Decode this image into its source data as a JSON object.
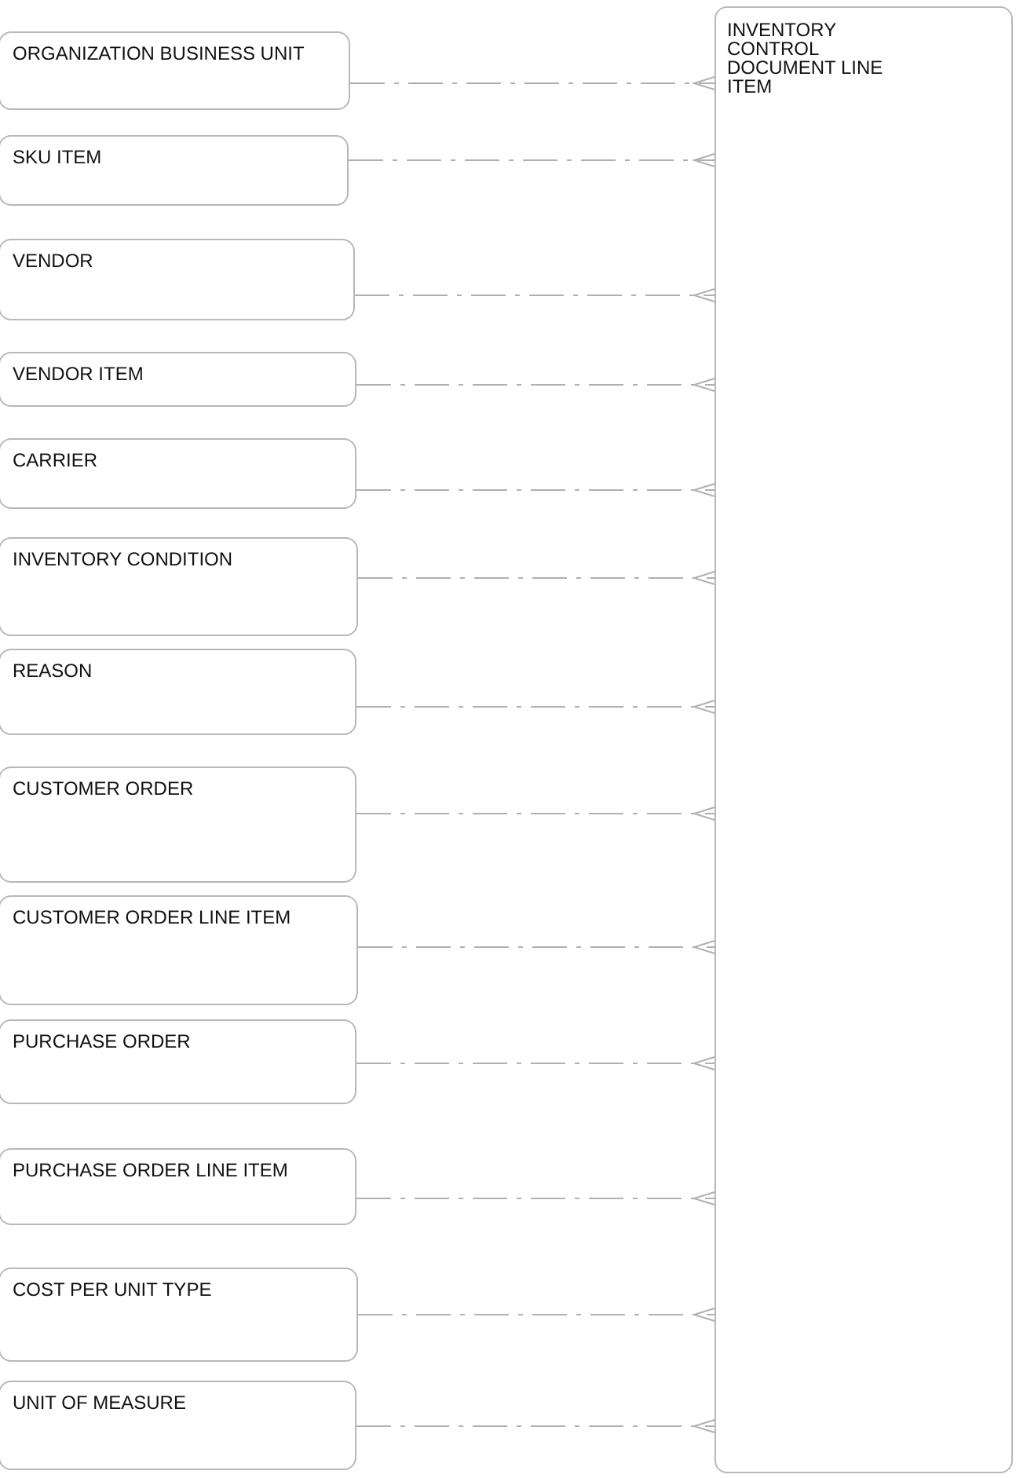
{
  "target_entity": {
    "name": "INVENTORY CONTROL DOCUMENT LINE ITEM"
  },
  "entities": [
    {
      "name": "ORGANIZATION BUSINESS UNIT"
    },
    {
      "name": "SKU ITEM"
    },
    {
      "name": "VENDOR"
    },
    {
      "name": "VENDOR ITEM"
    },
    {
      "name": "CARRIER"
    },
    {
      "name": "INVENTORY CONDITION"
    },
    {
      "name": "REASON"
    },
    {
      "name": "CUSTOMER ORDER"
    },
    {
      "name": "CUSTOMER ORDER LINE ITEM"
    },
    {
      "name": "PURCHASE ORDER"
    },
    {
      "name": "PURCHASE ORDER LINE ITEM"
    },
    {
      "name": "COST PER UNIT TYPE"
    },
    {
      "name": "UNIT OF MEASURE"
    }
  ]
}
